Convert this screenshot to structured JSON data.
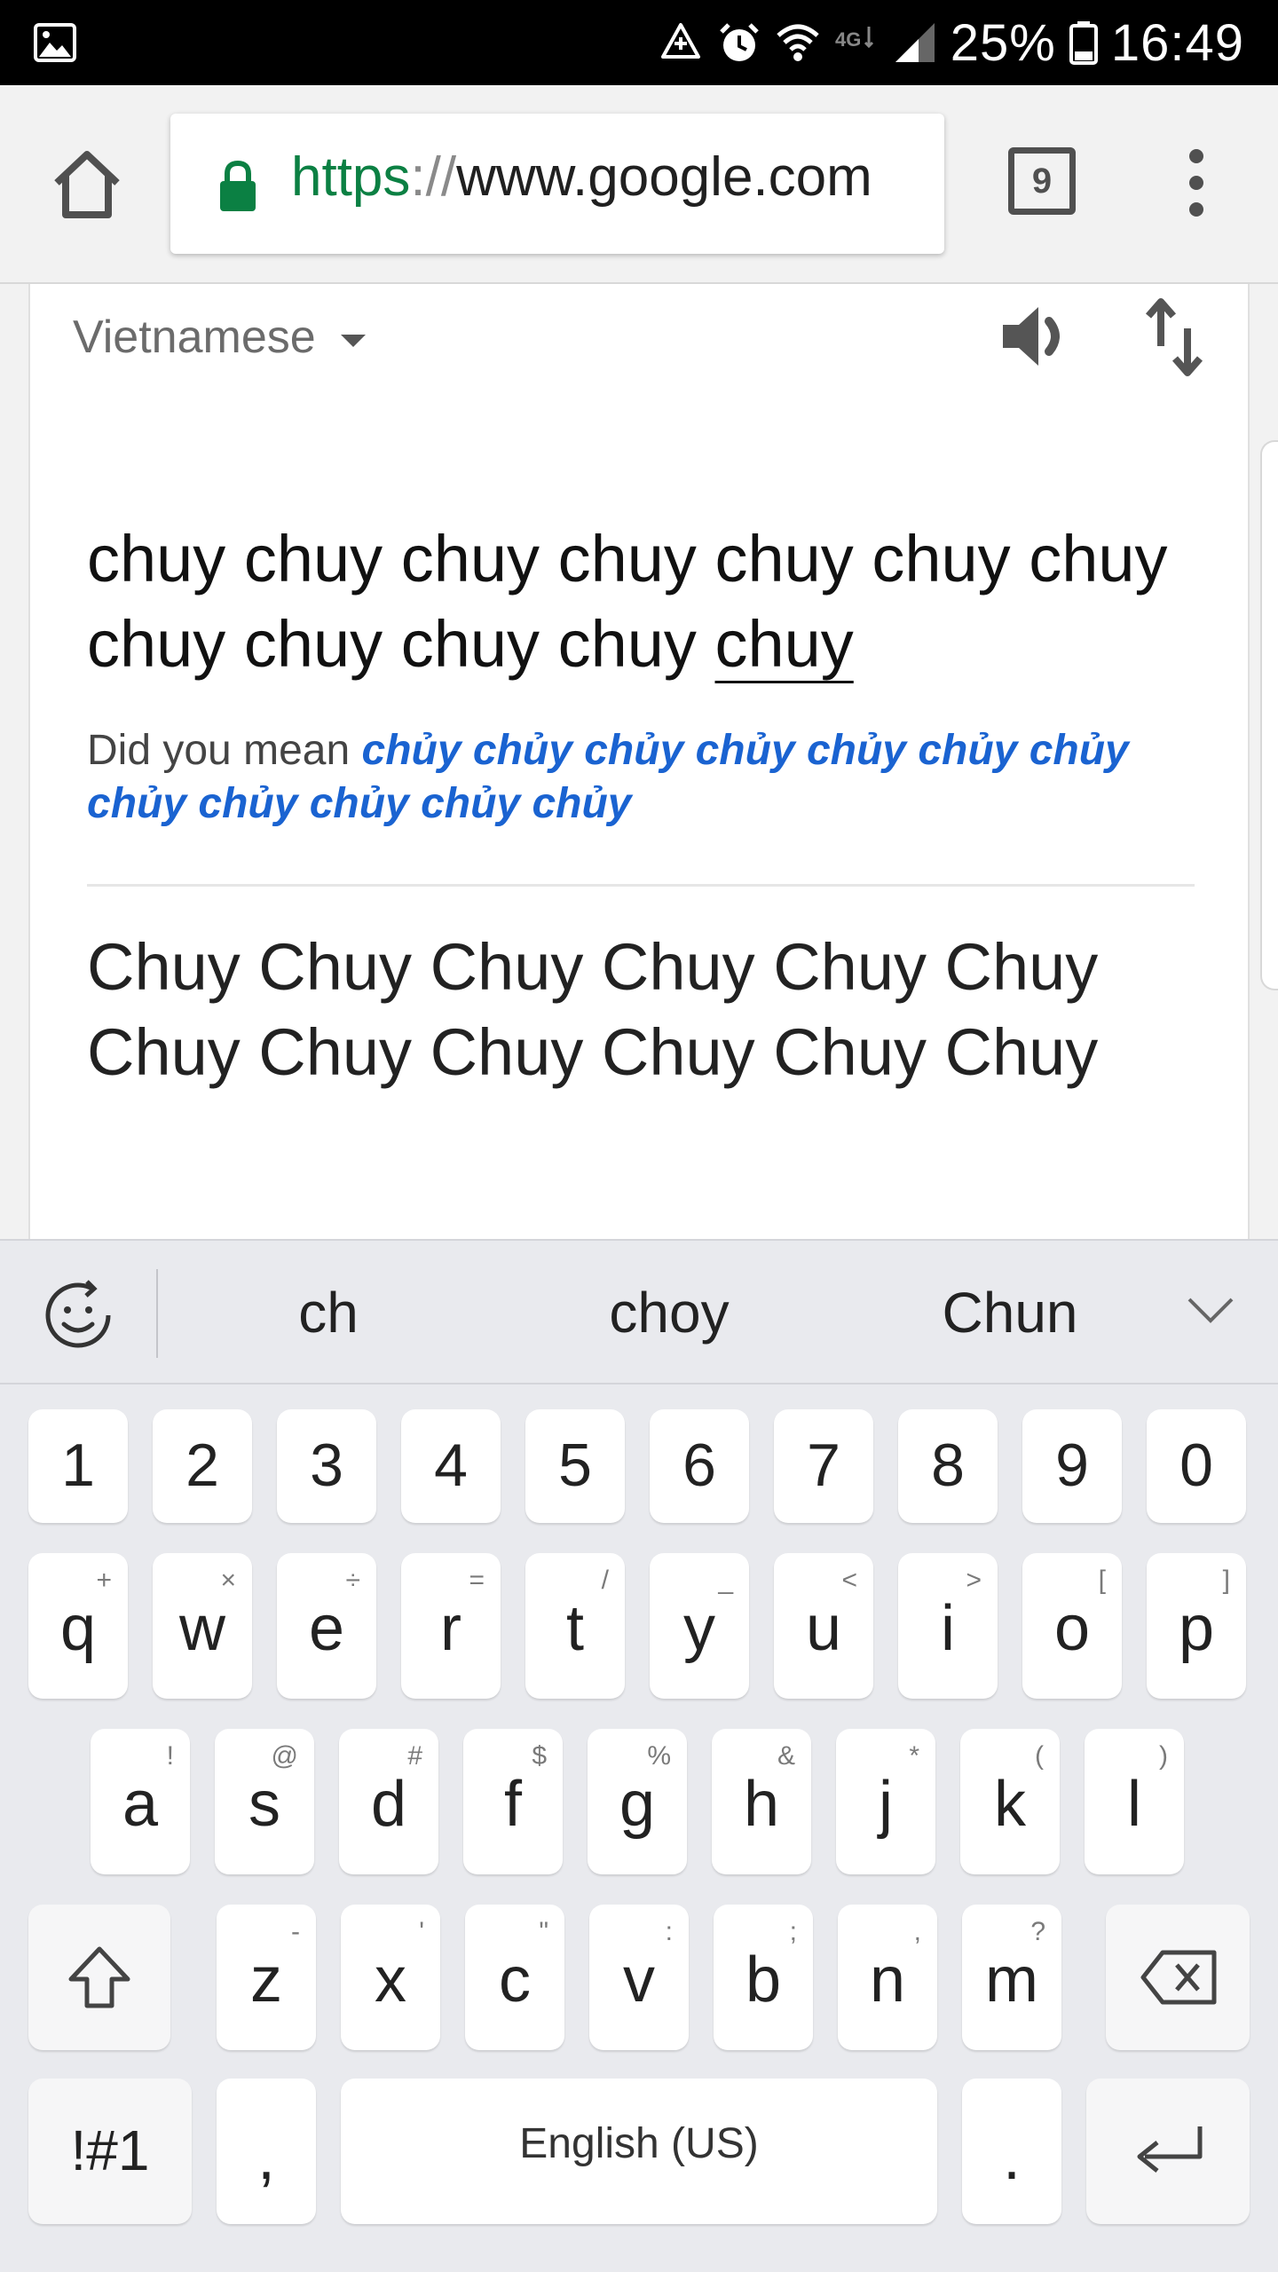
{
  "status_bar": {
    "battery": "25%",
    "time": "16:49",
    "icons": [
      "image-icon",
      "data-saver-icon",
      "alarm-icon",
      "wifi-icon",
      "4g-lte-icon",
      "signal-icon",
      "battery-icon"
    ]
  },
  "browser": {
    "url_scheme": "https",
    "url_sep": "://",
    "url_host": "www.google.com",
    "tab_count": "9",
    "colors": {
      "secure": "#0b8043",
      "toolbar_bg": "#f2f2f2"
    }
  },
  "translate": {
    "source_language": "Vietnamese",
    "source_text": "chuy chuy chuy chuy chuy chuy chuy chuy chuy chuy chuy",
    "source_text_last": "chuy",
    "did_you_mean_label": "Did you mean",
    "did_you_mean_suggestion": "chủy chủy chủy chủy chủy chủy chủy chủy chủy chủy chủy chủy",
    "translation": "Chuy Chuy Chuy Chuy Chuy Chuy Chuy Chuy Chuy Chuy Chuy Chuy",
    "colors": {
      "suggestion": "#1a63d1"
    }
  },
  "keyboard": {
    "suggestions": [
      "ch",
      "choy",
      "Chun"
    ],
    "number_row": [
      "1",
      "2",
      "3",
      "4",
      "5",
      "6",
      "7",
      "8",
      "9",
      "0"
    ],
    "row1": [
      {
        "key": "q",
        "hint": "+"
      },
      {
        "key": "w",
        "hint": "×"
      },
      {
        "key": "e",
        "hint": "÷"
      },
      {
        "key": "r",
        "hint": "="
      },
      {
        "key": "t",
        "hint": "/"
      },
      {
        "key": "y",
        "hint": "_"
      },
      {
        "key": "u",
        "hint": "<"
      },
      {
        "key": "i",
        "hint": ">"
      },
      {
        "key": "o",
        "hint": "["
      },
      {
        "key": "p",
        "hint": "]"
      }
    ],
    "row2": [
      {
        "key": "a",
        "hint": "!"
      },
      {
        "key": "s",
        "hint": "@"
      },
      {
        "key": "d",
        "hint": "#"
      },
      {
        "key": "f",
        "hint": "$"
      },
      {
        "key": "g",
        "hint": "%"
      },
      {
        "key": "h",
        "hint": "&"
      },
      {
        "key": "j",
        "hint": "*"
      },
      {
        "key": "k",
        "hint": "("
      },
      {
        "key": "l",
        "hint": ")"
      }
    ],
    "row3": [
      {
        "key": "z",
        "hint": "-"
      },
      {
        "key": "x",
        "hint": "'"
      },
      {
        "key": "c",
        "hint": "\""
      },
      {
        "key": "v",
        "hint": ":"
      },
      {
        "key": "b",
        "hint": ";"
      },
      {
        "key": "n",
        "hint": ","
      },
      {
        "key": "m",
        "hint": "?"
      }
    ],
    "symbols_label": "!#1",
    "comma": ",",
    "space_label": "English (US)",
    "period": "."
  }
}
